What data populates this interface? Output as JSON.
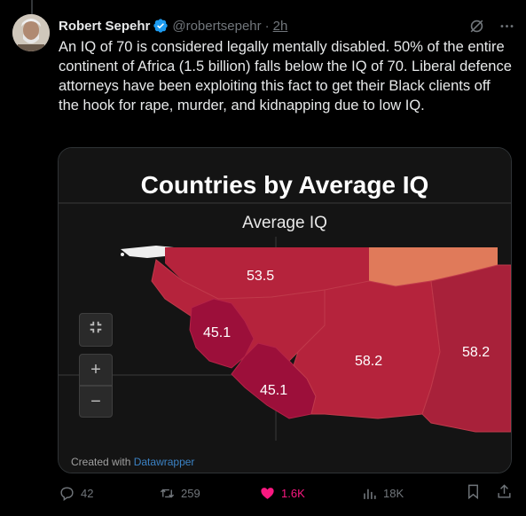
{
  "tweet": {
    "author_name": "Robert Sepehr",
    "handle": "@robertsepehr",
    "separator": "·",
    "time": "2h",
    "text": "An IQ of 70 is considered legally mentally disabled. 50% of the entire continent of Africa (1.5 billion) falls below the IQ of 70. Liberal defence attorneys have been exploiting this fact to get their Black clients off the hook for rape, murder, and kidnapping due to low IQ."
  },
  "media": {
    "title": "Countries by Average IQ",
    "legend_label": "Average IQ",
    "region_values": [
      "53.5",
      "45.1",
      "45.1",
      "58.2",
      "58.2"
    ],
    "zoom_in": "+",
    "zoom_out": "−",
    "credit_prefix": "Created with",
    "credit_link": "Datawrapper"
  },
  "actions": {
    "replies": "42",
    "retweets": "259",
    "likes": "1.6K",
    "views": "18K"
  },
  "colors": {
    "like_active": "#f91880",
    "verified": "#1d9bf0",
    "muted": "#71767b",
    "map_dark": "#9c0f3a",
    "map_mid": "#b5233c",
    "map_light": "#e07a5a"
  },
  "icons": [
    "verified-badge-icon",
    "grok-icon",
    "more-icon",
    "collapse-icon",
    "reply-icon",
    "retweet-icon",
    "heart-icon",
    "views-icon",
    "bookmark-icon",
    "share-icon"
  ]
}
